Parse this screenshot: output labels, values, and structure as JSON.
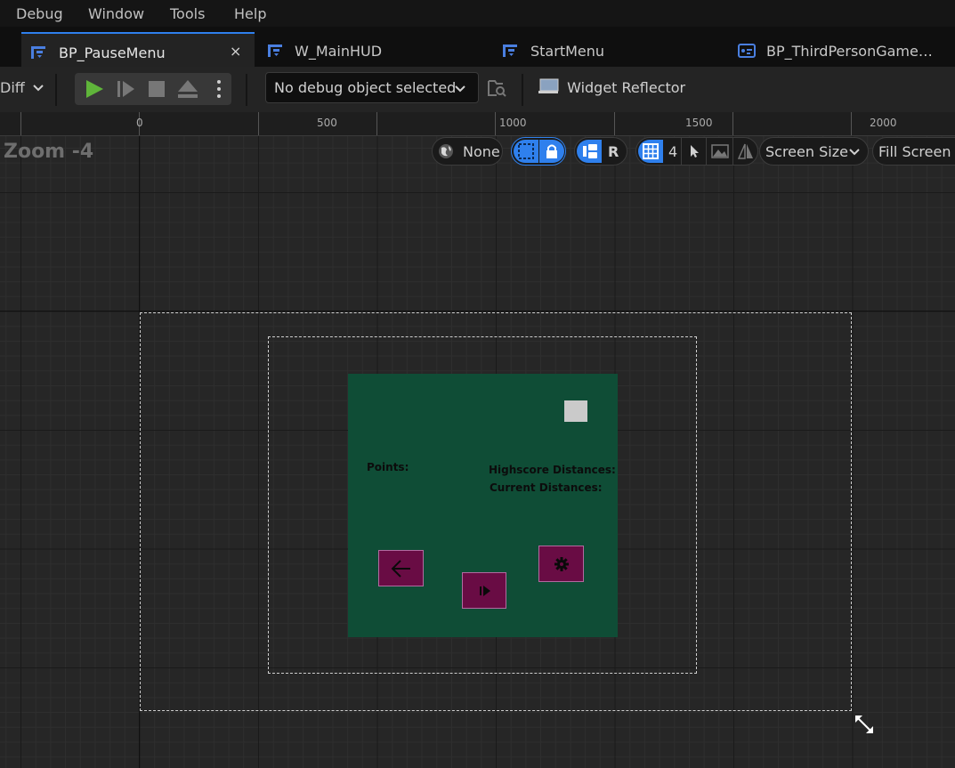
{
  "menubar": {
    "items": [
      "Debug",
      "Window",
      "Tools",
      "Help"
    ]
  },
  "tabs": [
    {
      "label": "BP_PauseMenu",
      "active": true,
      "close": "×"
    },
    {
      "label": "W_MainHUD",
      "active": false
    },
    {
      "label": "StartMenu",
      "active": false
    },
    {
      "label": "BP_ThirdPersonGame…",
      "active": false
    }
  ],
  "toolbar": {
    "diff_label": "Diff",
    "debug_select": "No debug object selected",
    "widget_reflector": "Widget Reflector"
  },
  "ruler": {
    "labels": [
      "0",
      "500",
      "1000",
      "1500",
      "2000"
    ]
  },
  "viewport": {
    "zoom_label": "Zoom -4",
    "localization_none": "None",
    "respect_locks_r": "R",
    "grid_snap_value": "4",
    "screen_size": "Screen Size",
    "fill_screen": "Fill Screen"
  },
  "widget": {
    "points_label": "Points:",
    "highscore_label": "Highscore Distances:",
    "current_label": "Current Distances:"
  },
  "colors": {
    "accent": "#2f80ed",
    "play": "#5fb53a",
    "panel": "#0f4d36",
    "button": "#690c44"
  }
}
